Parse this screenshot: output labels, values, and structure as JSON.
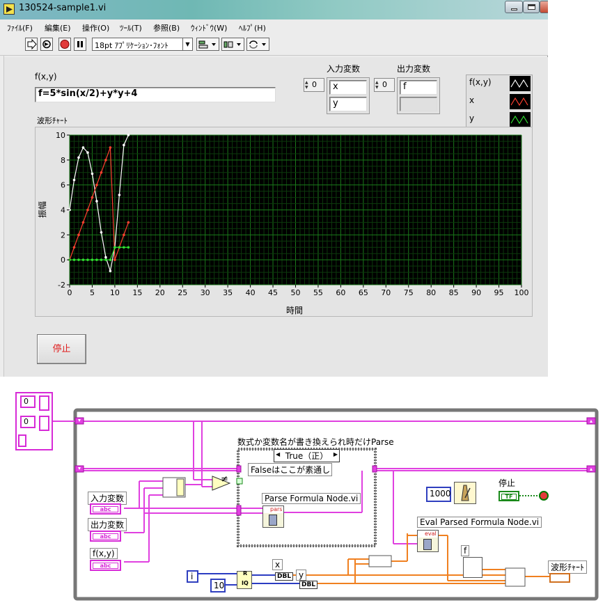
{
  "window": {
    "title": "130524-sample1.vi"
  },
  "menu": [
    "ﾌｧｲﾙ(F)",
    "編集(E)",
    "操作(O)",
    "ﾂｰﾙ(T)",
    "参照(B)",
    "ｳｨﾝﾄﾞｳ(W)",
    "ﾍﾙﾌﾟ(H)"
  ],
  "toolbar": {
    "font": "18pt ｱﾌﾟﾘｹｰｼｮﾝ･ﾌｫﾝﾄ"
  },
  "panel": {
    "formula_label": "f(x,y)",
    "formula_value": "f=5*sin(x/2)+y*y+4",
    "input_vars_label": "入力変数",
    "input_index": "0",
    "input_vars": [
      "x",
      "y"
    ],
    "output_vars_label": "出力変数",
    "output_index": "0",
    "output_vars": [
      "f",
      ""
    ],
    "chart_label": "波形ﾁｬｰﾄ",
    "stop_label": "停止",
    "legend": [
      {
        "name": "f(x,y)",
        "color": "#ffffff"
      },
      {
        "name": "x",
        "color": "#ff4030"
      },
      {
        "name": "y",
        "color": "#30e030"
      }
    ]
  },
  "chart_data": {
    "type": "line",
    "xlabel": "時間",
    "ylabel": "振幅",
    "xlim": [
      0,
      100
    ],
    "ylim": [
      -2,
      10
    ],
    "xticks": [
      0,
      5,
      10,
      15,
      20,
      25,
      30,
      35,
      40,
      45,
      50,
      55,
      60,
      65,
      70,
      75,
      80,
      85,
      90,
      95,
      100
    ],
    "yticks": [
      -2,
      0,
      2,
      4,
      6,
      8,
      10
    ],
    "grid": true,
    "series": [
      {
        "name": "f(x,y)",
        "color": "#ffffff",
        "x": [
          0,
          1,
          2,
          3,
          4,
          5,
          6,
          7,
          8,
          9,
          10,
          11,
          12,
          13
        ],
        "y": [
          4,
          6.4,
          8.2,
          9,
          8.6,
          6.9,
          4.7,
          2.2,
          0.2,
          -0.9,
          1,
          5.2,
          9.2,
          10
        ]
      },
      {
        "name": "x",
        "color": "#ff4030",
        "x": [
          0,
          1,
          2,
          3,
          4,
          5,
          6,
          7,
          8,
          9,
          10,
          11,
          12,
          13
        ],
        "y": [
          0,
          1,
          2,
          3,
          4,
          5,
          6,
          7,
          8,
          9,
          0,
          1,
          2,
          3
        ]
      },
      {
        "name": "y",
        "color": "#30e030",
        "x": [
          0,
          1,
          2,
          3,
          4,
          5,
          6,
          7,
          8,
          9,
          10,
          11,
          12,
          13
        ],
        "y": [
          0,
          0,
          0,
          0,
          0,
          0,
          0,
          0,
          0,
          0,
          1,
          1,
          1,
          1
        ]
      }
    ]
  },
  "diagram": {
    "case_title": "数式か変数名が書き換えられ時だけParse",
    "case_selector": "True（正）",
    "false_note": "Falseはここが素通し",
    "parse_vi": "Parse Formula Node.vi",
    "parse_tag": "pars",
    "eval_vi": "Eval Parsed Formula Node.vi",
    "eval_tag": "eval",
    "input_vars_label": "入力変数",
    "output_vars_label": "出力変数",
    "formula_label": "f(x,y)",
    "ctrl_tag": "abc",
    "wait_ms": "1000",
    "stop_label": "停止",
    "stop_tag": "TF",
    "chart_label": "波形ﾁｬｰﾄ",
    "x_label": "x",
    "y_label": "y",
    "f_label": "f",
    "dbl": "DBL",
    "iter": "i",
    "divisor": "10",
    "r_label": "R",
    "iq_label": "IQ",
    "arr_idx": "0",
    "neq": "≠"
  }
}
